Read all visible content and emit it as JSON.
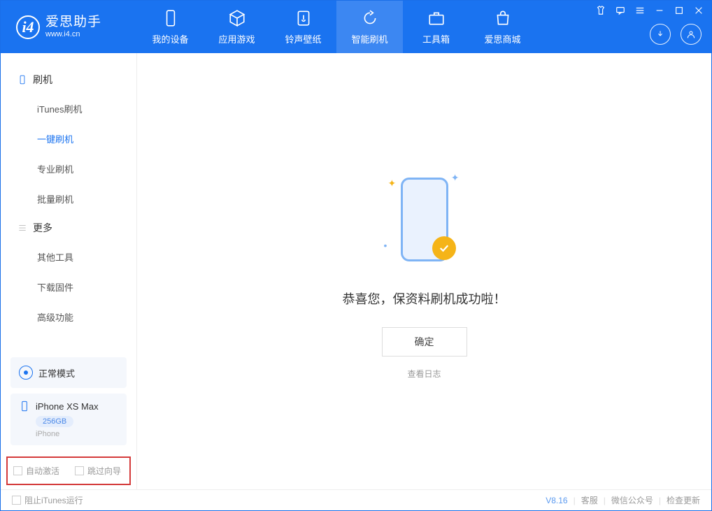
{
  "logo": {
    "cn": "爱思助手",
    "en": "www.i4.cn"
  },
  "nav": {
    "device": "我的设备",
    "apps": "应用游戏",
    "ringtone": "铃声壁纸",
    "flash": "智能刷机",
    "toolbox": "工具箱",
    "store": "爱思商城"
  },
  "sidebar": {
    "group_flash": "刷机",
    "items_flash": {
      "itunes": "iTunes刷机",
      "oneclick": "一键刷机",
      "pro": "专业刷机",
      "batch": "批量刷机"
    },
    "group_more": "更多",
    "items_more": {
      "other": "其他工具",
      "firmware": "下载固件",
      "advanced": "高级功能"
    }
  },
  "mode": {
    "label": "正常模式"
  },
  "device": {
    "name": "iPhone XS Max",
    "capacity": "256GB",
    "type": "iPhone"
  },
  "options": {
    "auto_activate": "自动激活",
    "skip_guide": "跳过向导"
  },
  "content": {
    "message": "恭喜您，保资料刷机成功啦！",
    "ok": "确定",
    "view_log": "查看日志"
  },
  "footer": {
    "block_itunes": "阻止iTunes运行",
    "version": "V8.16",
    "support": "客服",
    "wechat": "微信公众号",
    "update": "检查更新"
  }
}
